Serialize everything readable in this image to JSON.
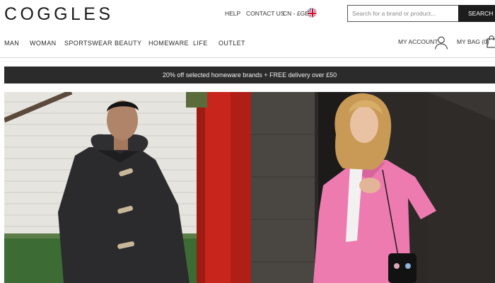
{
  "brand": {
    "logo_text": "COGGLES"
  },
  "utility": {
    "help": "HELP",
    "contact": "CONTACT US",
    "currency": "CN - £GBP"
  },
  "search": {
    "placeholder": "Search for a brand or product...",
    "button_label": "SEARCH"
  },
  "nav": {
    "items": [
      {
        "label": "MAN"
      },
      {
        "label": "WOMAN"
      },
      {
        "label": "SPORTSWEAR"
      },
      {
        "label": "BEAUTY"
      },
      {
        "label": "HOMEWARE"
      },
      {
        "label": "LIFE"
      },
      {
        "label": "OUTLET"
      }
    ]
  },
  "account": {
    "label": "MY ACCOUNT",
    "icon": "user-icon"
  },
  "bag": {
    "label": "MY BAG (0)",
    "icon": "shopping-bag-icon"
  },
  "promo": {
    "text": "20% off selected homeware brands + FREE delivery over £50"
  },
  "colors": {
    "header_bg": "#ffffff",
    "text": "#222222",
    "promo_bg": "#2b2b2b",
    "search_button_bg": "#1d1d1d",
    "hero_red": "#c8261c",
    "coat_pink": "#ee7bb0"
  }
}
